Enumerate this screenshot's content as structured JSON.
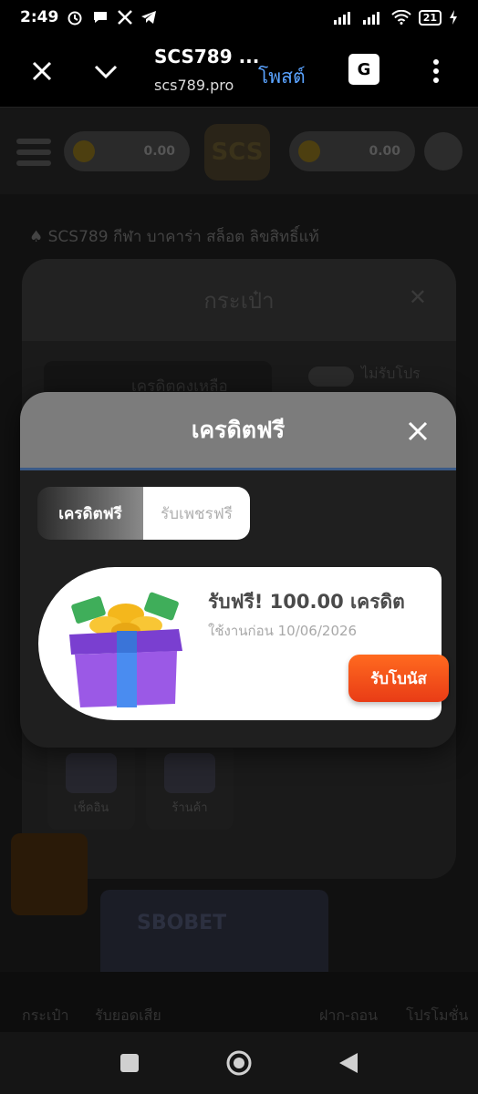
{
  "status_bar": {
    "time": "2:49",
    "battery": "21"
  },
  "browser": {
    "title": "SCS789 ...",
    "url": "scs789.pro",
    "post_label": "โพสต์",
    "translate_label": "G"
  },
  "background": {
    "balance_left": "0.00",
    "balance_right": "0.00",
    "logo": "SCS",
    "marquee": "♠ SCS789 กีฬา บาคาร่า สล็อต ลิขสิทธิ์แท้",
    "wallet_title": "กระเป๋า",
    "credit_remaining": "เครดิตคงเหลือ",
    "no_promo": "ไม่รับโปร",
    "tiles": [
      {
        "label": "เช็คอิน"
      },
      {
        "label": "ร้านค้า"
      }
    ],
    "banner": "SBOBET",
    "nav": [
      {
        "label": "กระเป๋า"
      },
      {
        "label": "รับยอดเสีย"
      },
      {
        "label": "ฝาก-ถอน"
      },
      {
        "label": "โปรโมชั่น"
      }
    ]
  },
  "modal": {
    "title": "เครดิตฟรี",
    "tabs": [
      {
        "label": "เครดิตฟรี",
        "active": true
      },
      {
        "label": "รับเพชรฟรี",
        "active": false
      }
    ],
    "bonus": {
      "title": "รับฟรี! 100.00 เครดิต",
      "expiry": "ใช้งานก่อน 10/06/2026",
      "claim_label": "รับโบนัส"
    }
  },
  "colors": {
    "accent": "#e93c16",
    "header_gray": "#7c7c7c",
    "link_blue": "#5aa3ff"
  }
}
